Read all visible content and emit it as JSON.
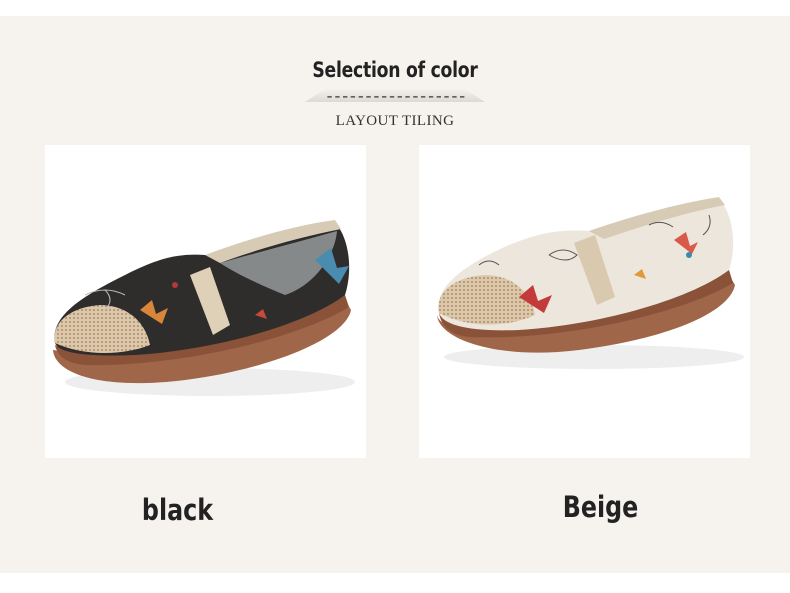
{
  "header": {
    "title": "Selection of color",
    "dashes": "------------------",
    "subtitle": "LAYOUT TILING"
  },
  "products": [
    {
      "color_name": "black",
      "image": "black-butterfly-slip-on-shoe"
    },
    {
      "color_name": "Beige",
      "image": "beige-butterfly-slip-on-shoe"
    }
  ],
  "colors": {
    "panel_background": "#f6f2ee",
    "sole": "#a0664a",
    "black_upper": "#2f2d2c",
    "beige_upper": "#ece6dc",
    "linen_toe": "#d9c4a8"
  }
}
